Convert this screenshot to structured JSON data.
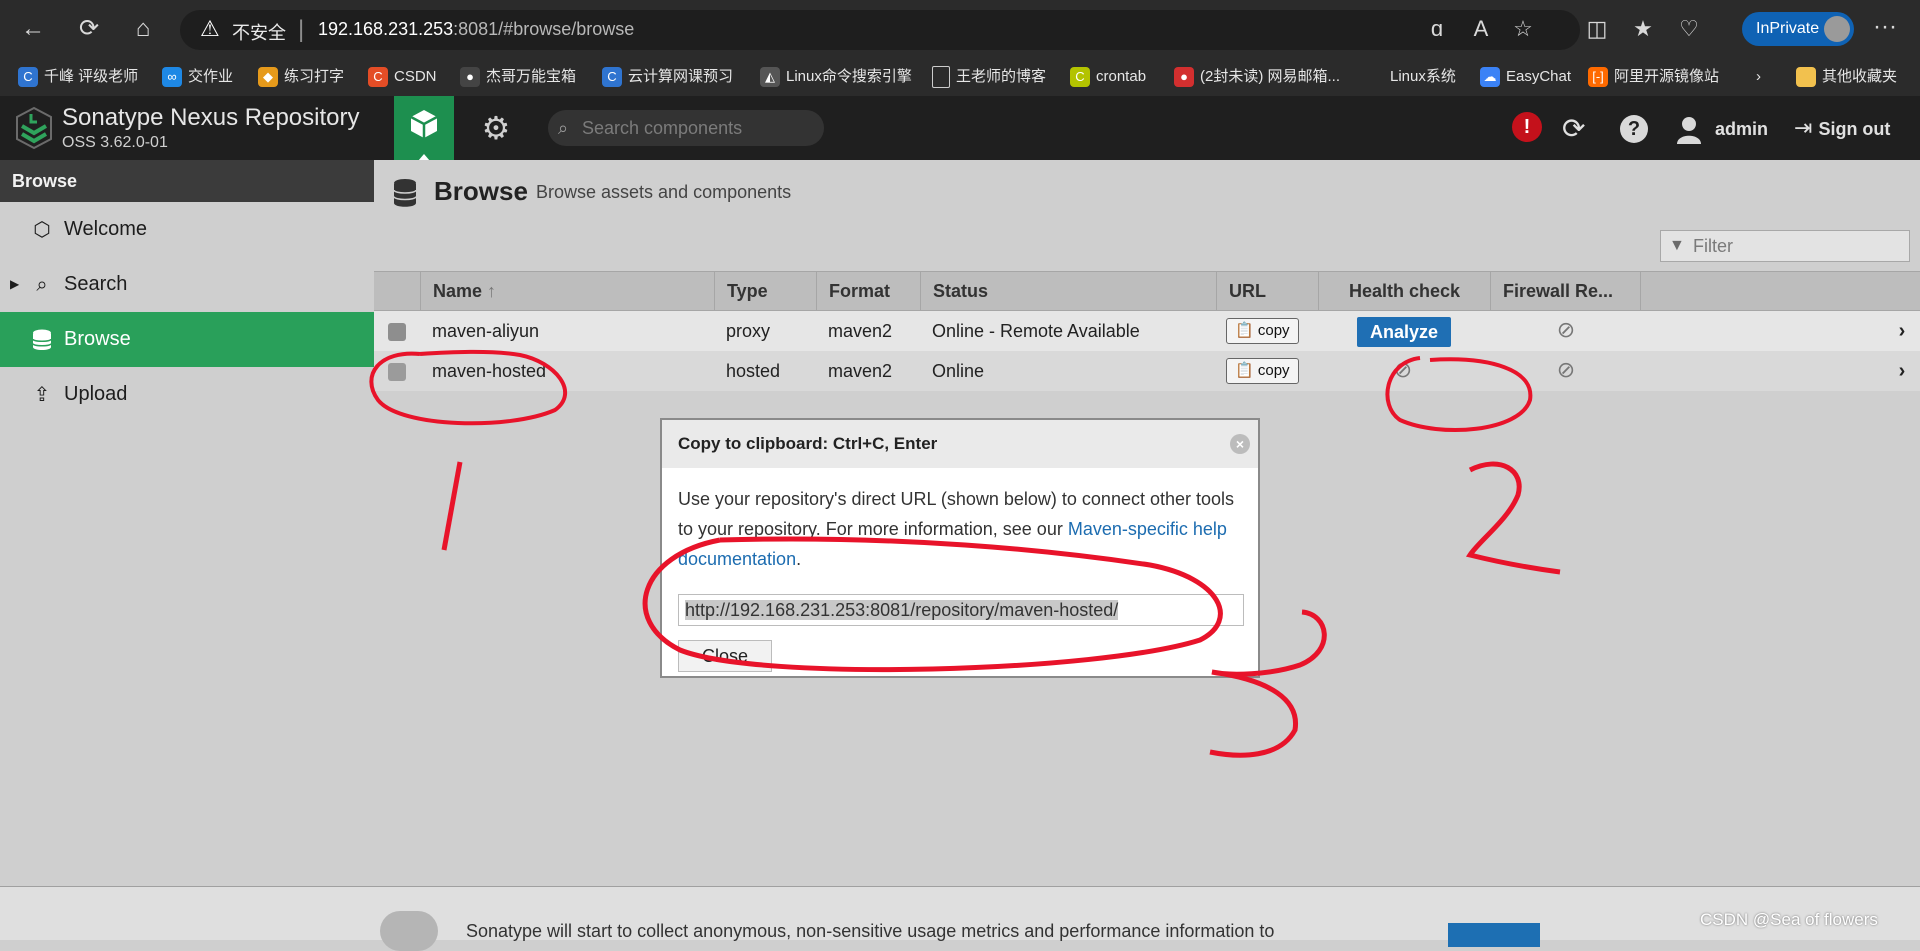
{
  "browser": {
    "insecure_label": "不安全",
    "url_host": "192.168.231.253",
    "url_rest": ":8081/#browse/browse",
    "inprivate": "InPrivate"
  },
  "bookmarks": [
    {
      "label": "千峰 评级老师",
      "color": "#2f74d0"
    },
    {
      "label": "交作业",
      "color": "#1e88e5"
    },
    {
      "label": "练习打字",
      "color": "#e69a1b"
    },
    {
      "label": "CSDN",
      "color": "#e44d26"
    },
    {
      "label": "杰哥万能宝箱",
      "color": "#444444"
    },
    {
      "label": "云计算网课预习",
      "color": "#2f74d0"
    },
    {
      "label": "Linux命令搜索引擎",
      "color": "#555555"
    },
    {
      "label": "王老师的博客",
      "color": "#666666"
    },
    {
      "label": "crontab",
      "color": "#b3c300"
    },
    {
      "label": "(2封未读) 网易邮箱...",
      "color": "#d32f2f"
    },
    {
      "label": "Linux系统",
      "color": "#2b2b2b"
    },
    {
      "label": "EasyChat",
      "color": "#3b82f6"
    },
    {
      "label": "阿里开源镜像站",
      "color": "#ff6a00"
    },
    {
      "label": "其他收藏夹",
      "color": "#f2c14e"
    }
  ],
  "nexus": {
    "brand": "Sonatype Nexus Repository",
    "version": "OSS 3.62.0-01",
    "search_placeholder": "Search components",
    "user": "admin",
    "sign_out": "Sign out"
  },
  "sidebar": {
    "header": "Browse",
    "items": [
      {
        "label": "Welcome"
      },
      {
        "label": "Search"
      },
      {
        "label": "Browse"
      },
      {
        "label": "Upload"
      }
    ]
  },
  "main": {
    "title": "Browse",
    "subtitle": "Browse assets and components",
    "filter_placeholder": "Filter",
    "columns": {
      "name": "Name",
      "type": "Type",
      "format": "Format",
      "status": "Status",
      "url": "URL",
      "health": "Health check",
      "firewall": "Firewall Re..."
    },
    "rows": [
      {
        "name": "maven-aliyun",
        "type": "proxy",
        "format": "maven2",
        "status": "Online - Remote Available",
        "copy": "copy",
        "health": "Analyze"
      },
      {
        "name": "maven-hosted",
        "type": "hosted",
        "format": "maven2",
        "status": "Online",
        "copy": "copy"
      }
    ]
  },
  "modal": {
    "title": "Copy to clipboard: Ctrl+C, Enter",
    "body_text": "Use your repository's direct URL (shown below) to connect other tools to your repository. For more information, see our ",
    "link_text": "Maven-specific help documentation",
    "body_end": ".",
    "url": "http://192.168.231.253:8081/repository/maven-hosted/",
    "close": "Close"
  },
  "footer": {
    "text": "Sonatype will start to collect anonymous, non-sensitive usage metrics and performance information to"
  },
  "watermark": "CSDN @Sea of flowers",
  "colors": {
    "accent": "#29a05a",
    "header": "#1f1f1f",
    "link": "#1c6cb0",
    "annotation": "#e8132a"
  }
}
